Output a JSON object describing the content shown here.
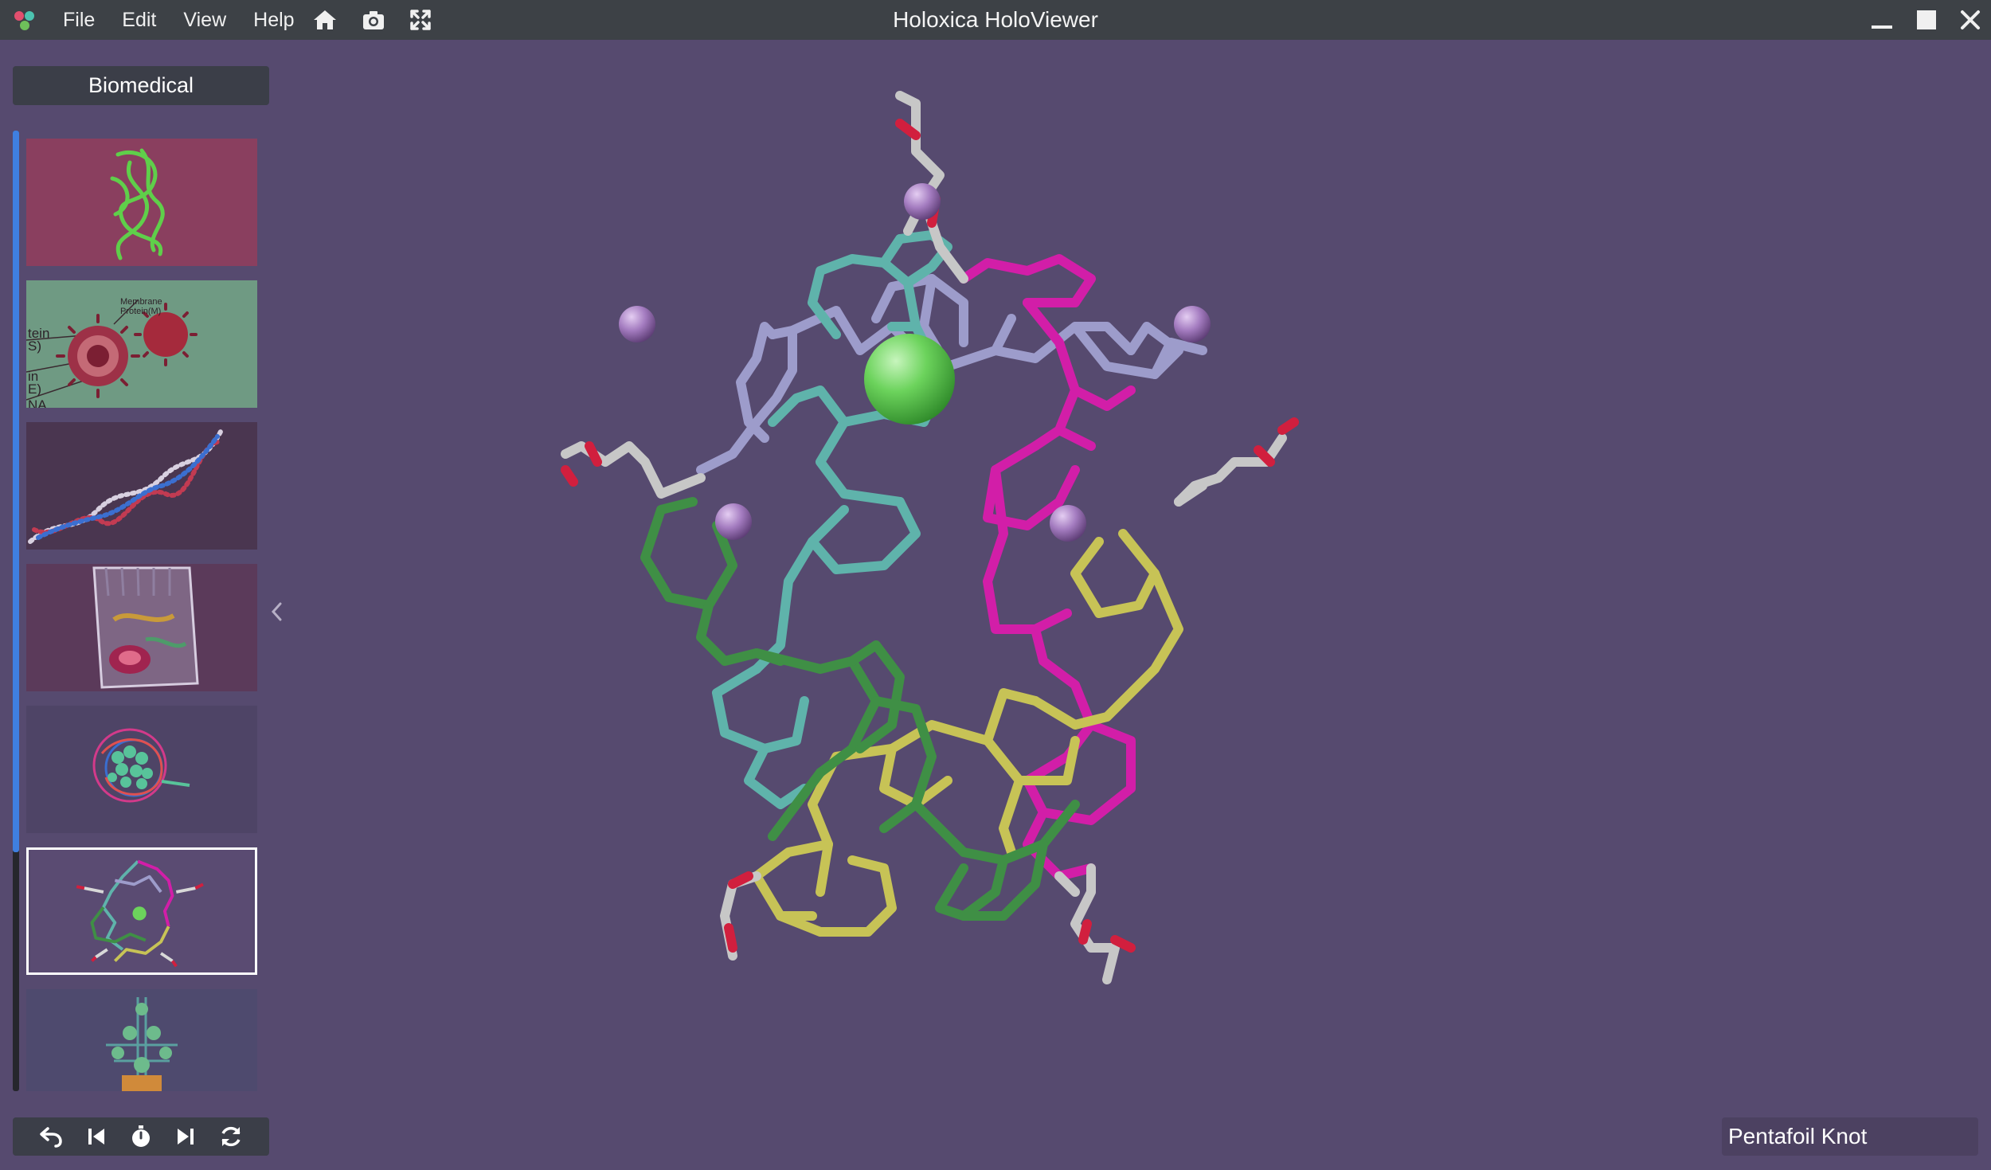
{
  "window": {
    "title": "Holoxica HoloViewer",
    "menu": [
      "File",
      "Edit",
      "View",
      "Help"
    ],
    "toolbar_icons": [
      "home-icon",
      "camera-icon",
      "fullscreen-icon"
    ],
    "controls": [
      "minimize-icon",
      "maximize-icon",
      "close-icon"
    ]
  },
  "sidebar": {
    "category": "Biomedical",
    "thumbnails": [
      {
        "subject": "green-protein",
        "bg": "#8a3f5f",
        "selected": false
      },
      {
        "subject": "virus-diagram",
        "bg": "#6f9a83",
        "selected": false,
        "labels": [
          "Membrane",
          "Protein(M)",
          "tein",
          "S)",
          "in",
          "E)",
          "NA"
        ]
      },
      {
        "subject": "dna-helix",
        "bg": "#4a3650",
        "selected": false
      },
      {
        "subject": "cell-model",
        "bg": "#5b3a5a",
        "selected": false
      },
      {
        "subject": "protein-globule",
        "bg": "#4e4466",
        "selected": false
      },
      {
        "subject": "pentafoil-knot",
        "bg": "#5a4b72",
        "selected": true
      },
      {
        "subject": "tree-structure",
        "bg": "#4e4a6e",
        "selected": false
      }
    ]
  },
  "bottom_toolbar": [
    "undo-icon",
    "previous-icon",
    "timer-icon",
    "next-icon",
    "refresh-icon"
  ],
  "model": {
    "name": "Pentafoil Knot",
    "colors": {
      "teal": "#5fb3ab",
      "green": "#3f8f45",
      "yellow": "#c7c356",
      "magenta": "#d21ea8",
      "lavender": "#9d9ccb",
      "metal_ion": "#a47cc0",
      "chloride": "#6cd35c",
      "oxygen": "#d11f3e",
      "carbon": "#c7c7c7"
    }
  }
}
